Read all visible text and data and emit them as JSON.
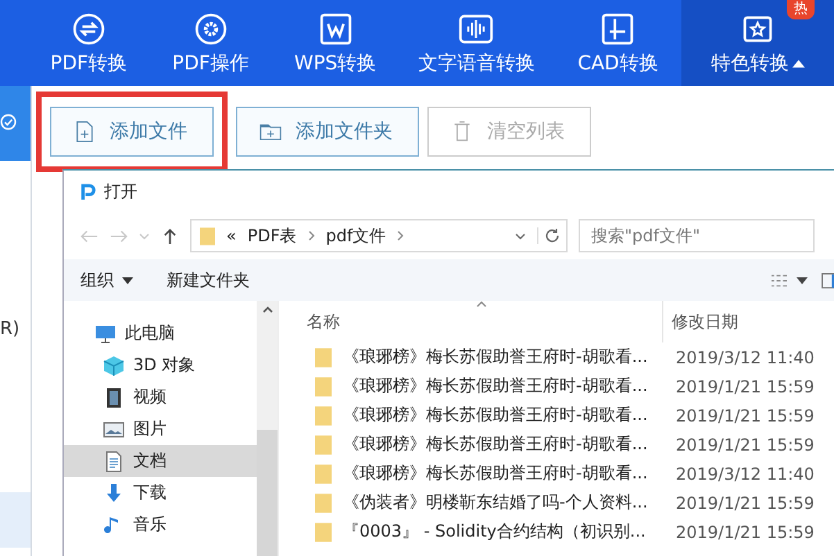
{
  "nav_tabs": [
    {
      "label": "PDF转换",
      "selected": false
    },
    {
      "label": "PDF操作",
      "selected": false
    },
    {
      "label": "WPS转换",
      "selected": false
    },
    {
      "label": "文字语音转换",
      "selected": false
    },
    {
      "label": "CAD转换",
      "selected": false
    },
    {
      "label": "特色转换",
      "selected": true,
      "badge": "热"
    }
  ],
  "left_strip": {
    "text": "R)"
  },
  "toolbar": [
    {
      "label": "添加文件",
      "kind": "add_file",
      "disabled": false,
      "highlighted": true
    },
    {
      "label": "添加文件夹",
      "kind": "add_folder",
      "disabled": false,
      "highlighted": false
    },
    {
      "label": "清空列表",
      "kind": "clear",
      "disabled": true,
      "highlighted": false
    }
  ],
  "dialog": {
    "title": "打开",
    "breadcrumb": [
      "«",
      "PDF表",
      "pdf文件"
    ],
    "search": {
      "placeholder": "搜索\"pdf文件\""
    },
    "commands": [
      {
        "label": "组织",
        "kind": "menu"
      },
      {
        "label": "新建文件夹",
        "kind": "plain"
      }
    ],
    "nav_items": [
      {
        "label": "此电脑",
        "selected": false
      },
      {
        "label": "3D 对象",
        "selected": false
      },
      {
        "label": "视频",
        "selected": false
      },
      {
        "label": "图片",
        "selected": false
      },
      {
        "label": "文档",
        "selected": true
      },
      {
        "label": "下载",
        "selected": false
      },
      {
        "label": "音乐",
        "selected": false
      }
    ],
    "columns": [
      "名称",
      "修改日期"
    ],
    "rows": [
      {
        "name": "《琅琊榜》梅长苏假助誉王府时-胡歌看...",
        "date": "2019/3/12 11:40"
      },
      {
        "name": "《琅琊榜》梅长苏假助誉王府时-胡歌看...",
        "date": "2019/1/21 15:59"
      },
      {
        "name": "《琅琊榜》梅长苏假助誉王府时-胡歌看...",
        "date": "2019/1/21 15:59"
      },
      {
        "name": "《琅琊榜》梅长苏假助誉王府时-胡歌看...",
        "date": "2019/1/21 15:59"
      },
      {
        "name": "《琅琊榜》梅长苏假助誉王府时-胡歌看...",
        "date": "2019/3/12 11:40"
      },
      {
        "name": "《伪装者》明楼靳东结婚了吗-个人资料...",
        "date": "2019/1/21 15:59"
      },
      {
        "name": "『0003』 - Solidity合约结构（初识别...",
        "date": "2019/1/21 15:59"
      }
    ]
  }
}
